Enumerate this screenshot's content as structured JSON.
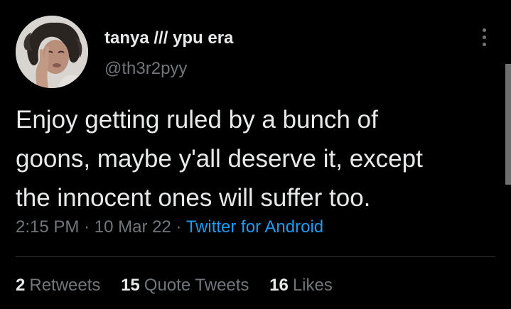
{
  "tweet": {
    "display_name": "tanya /// ypu era",
    "handle": "@th3r2pyy",
    "text_lines": [
      "Enjoy getting ruled by a bunch of",
      "goons, maybe y'all deserve it, except",
      "the innocent ones will suffer too."
    ],
    "time": "2:15 PM",
    "separator": "·",
    "date": "10 Mar 22",
    "source": "Twitter for Android",
    "avatar_icon": "profile-photo",
    "more_icon": "more-vertical-icon"
  },
  "stats": {
    "retweets_count": "2",
    "retweets_label": "Retweets",
    "quotes_count": "15",
    "quotes_label": "Quote Tweets",
    "likes_count": "16",
    "likes_label": "Likes"
  },
  "colors": {
    "background": "#000000",
    "primary_text": "#e7e9ea",
    "secondary_text": "#71767b",
    "link": "#1d9bf0",
    "divider": "#2f3336"
  }
}
